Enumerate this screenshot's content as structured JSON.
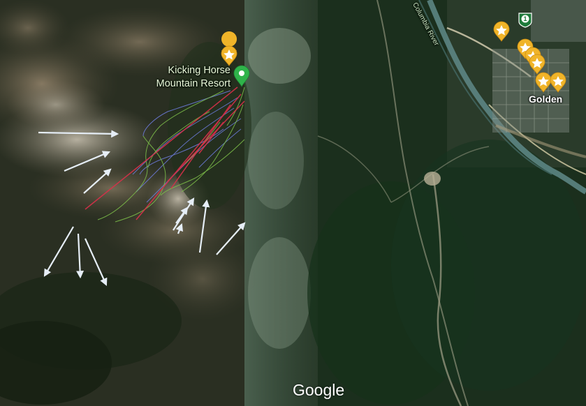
{
  "map": {
    "provider": "Google",
    "view": "satellite"
  },
  "labels": {
    "resort_line1": "Kicking Horse",
    "resort_line2": "Mountain Resort",
    "river": "Columbia River",
    "town": "Golden",
    "highway_shield": "1"
  },
  "attribution": "Google",
  "colors": {
    "pin_green": "#2fb34a",
    "star_marker": "#f0b429",
    "arrow": "#e6eef7",
    "ski_run_blue": "#6f7de0",
    "ski_run_green": "#7fc24a",
    "lift_red": "#d9304a"
  },
  "icons": {
    "place_pin": "green-place-pin-icon",
    "star_markers": "starred-place-marker-icon",
    "highway_shield": "trans-canada-highway-shield-icon"
  },
  "annotations": {
    "arrow_count": 11,
    "arrow_color": "#e6eef7"
  }
}
